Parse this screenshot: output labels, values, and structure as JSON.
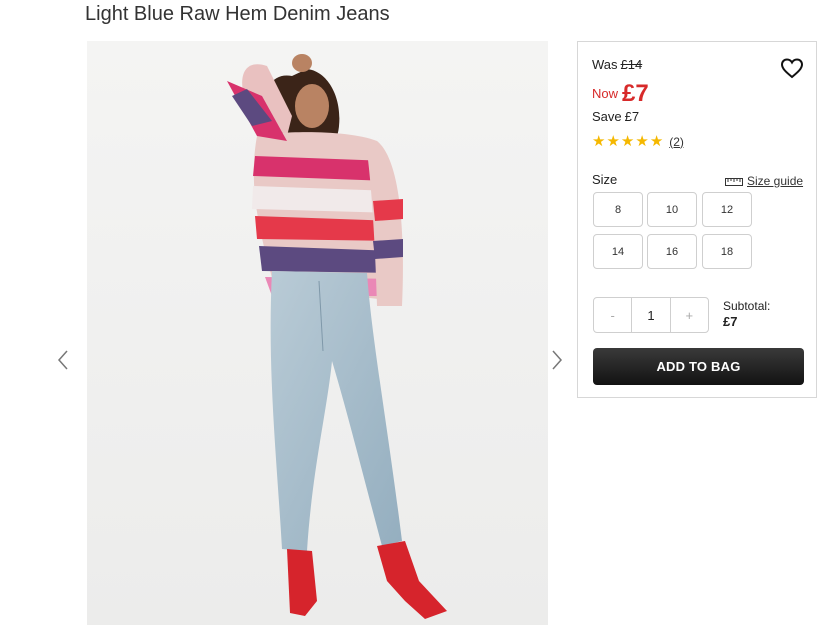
{
  "product": {
    "title": "Light Blue Raw Hem Denim Jeans"
  },
  "pricing": {
    "was_label": "Was",
    "was_price": "£14",
    "now_label": "Now",
    "now_price": "£7",
    "save_label": "Save",
    "save_amount": "£7"
  },
  "rating": {
    "stars": 5,
    "count": "(2)"
  },
  "size": {
    "label": "Size",
    "guide_label": "Size guide",
    "options": [
      "8",
      "10",
      "12",
      "14",
      "16",
      "18"
    ]
  },
  "quantity": {
    "minus": "-",
    "value": "1",
    "plus": "+"
  },
  "subtotal": {
    "label": "Subtotal:",
    "amount": "£7"
  },
  "actions": {
    "add_to_bag": "ADD TO BAG"
  },
  "icons": {
    "wishlist": "heart-icon",
    "prev": "chevron-left-icon",
    "next": "chevron-right-icon",
    "ruler": "ruler-icon",
    "star": "star-icon"
  },
  "colors": {
    "sale_red": "#d72a2a",
    "star_gold": "#f5b800",
    "button_dark": "#1a1a1a"
  }
}
